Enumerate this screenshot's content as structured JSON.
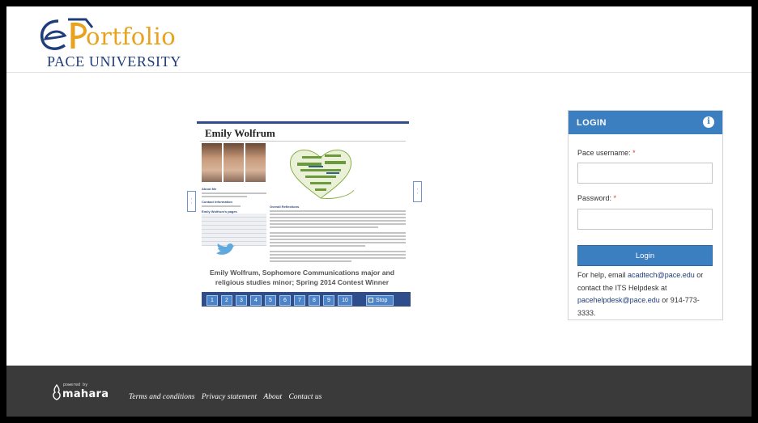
{
  "header": {
    "logo_word": "ortfolio",
    "logo_sub": "PACE UNIVERSITY"
  },
  "slideshow": {
    "slide_title": "Emily Wolfrum",
    "sidebar_head_1": "About Me",
    "sidebar_head_2": "Contact information",
    "sidebar_head_3": "Emily Wolfrum's pages",
    "article_head": "Overall Reflections",
    "caption_line1": "Emily Wolfrum, Sophomore Communications major and",
    "caption_line2": "religious studies minor; Spring 2014 Contest Winner",
    "pages": [
      "1",
      "2",
      "3",
      "4",
      "5",
      "6",
      "7",
      "8",
      "9",
      "10"
    ],
    "stop_label": "Stop"
  },
  "login": {
    "title": "LOGIN",
    "username_label": "Pace username:",
    "password_label": "Password:",
    "required_mark": "*",
    "username_value": "",
    "password_value": "",
    "button_label": "Login",
    "help_prefix": "For help, email ",
    "help_email": "acadtech@pace.edu",
    "help_mid": " or contact the ITS Helpdesk at ",
    "helpdesk_email": "pacehelpdesk@pace.edu",
    "help_suffix": " or 914-773-3333."
  },
  "footer": {
    "powered_by": "powered by",
    "mahara": "mahara",
    "links": [
      "Terms and conditions",
      "Privacy statement",
      "About",
      "Contact us"
    ]
  },
  "colors": {
    "brand_orange": "#e8a21e",
    "brand_navy": "#1f3d7a",
    "login_blue": "#3c7fc0",
    "footer_bg": "#3a3a3a"
  },
  "icons": [
    "eportfolio-logo",
    "info-icon",
    "mahara-logo-icon",
    "slide-prev-arrow",
    "slide-next-arrow",
    "stop-icon"
  ]
}
